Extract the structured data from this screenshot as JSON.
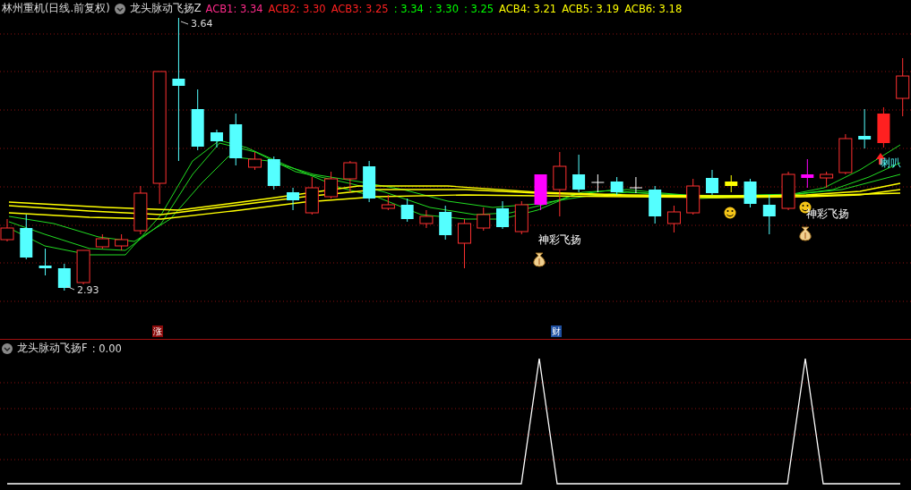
{
  "header": {
    "title": "林州重机(日线.前复权)",
    "indicator": "龙头脉动飞扬Z",
    "values": [
      {
        "text": "ACB1: 3.34",
        "color": "#ff2a8a"
      },
      {
        "text": "ACB2: 3.30",
        "color": "#ff2020"
      },
      {
        "text": "ACB3: 3.25",
        "color": "#ff2020"
      },
      {
        "text": ": 3.34",
        "color": "#00ff00"
      },
      {
        "text": ": 3.30",
        "color": "#00ff00"
      },
      {
        "text": ": 3.25",
        "color": "#00ff00"
      },
      {
        "text": "ACB4: 3.21",
        "color": "#ffff00"
      },
      {
        "text": "ACB5: 3.19",
        "color": "#ffff00"
      },
      {
        "text": "ACB6: 3.18",
        "color": "#ffff00"
      }
    ]
  },
  "main_chart": {
    "high_label": "3.64",
    "low_label": "2.93",
    "annotations": [
      {
        "text": "神彩飞扬"
      },
      {
        "text": "神彩飞扬"
      },
      {
        "text": "喇叭"
      }
    ],
    "markers": [
      {
        "text": "涨",
        "color": "#8b0a0a"
      },
      {
        "text": "财",
        "color": "#1e4fa0"
      }
    ]
  },
  "sub_pane": {
    "indicator": "龙头脉动飞扬F",
    "value": ": 0.00"
  }
}
